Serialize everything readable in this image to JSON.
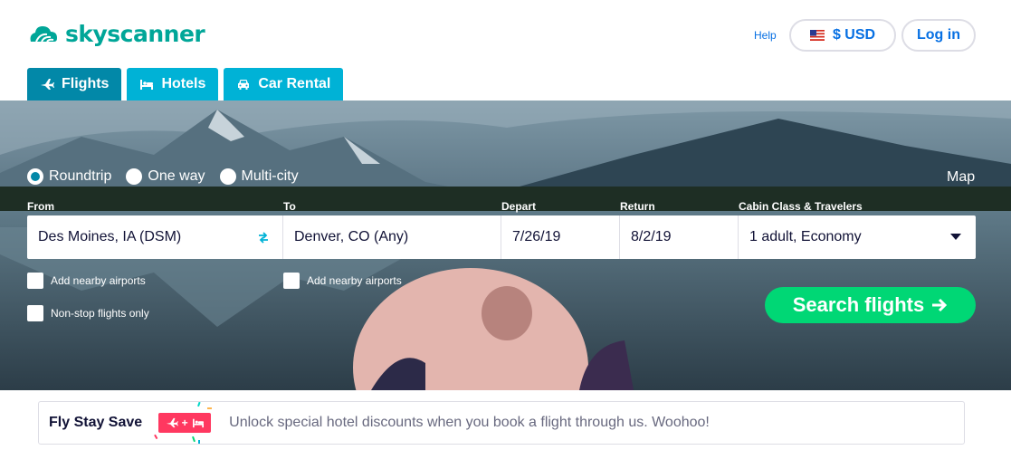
{
  "header": {
    "brand": "skyscanner",
    "help_label": "Help",
    "currency_label": "$ USD",
    "login_label": "Log in"
  },
  "tabs": [
    {
      "label": "Flights",
      "icon": "plane-icon",
      "active": true
    },
    {
      "label": "Hotels",
      "icon": "bed-icon",
      "active": false
    },
    {
      "label": "Car Rental",
      "icon": "car-icon",
      "active": false
    }
  ],
  "search": {
    "trip_types": [
      {
        "label": "Roundtrip",
        "checked": true
      },
      {
        "label": "One way",
        "checked": false
      },
      {
        "label": "Multi-city",
        "checked": false
      }
    ],
    "map_label": "Map",
    "labels": {
      "from": "From",
      "to": "To",
      "depart": "Depart",
      "return": "Return",
      "cabin": "Cabin Class & Travelers"
    },
    "values": {
      "from": "Des Moines, IA (DSM)",
      "to": "Denver, CO (Any)",
      "depart": "7/26/19",
      "return": "8/2/19",
      "cabin": "1 adult, Economy"
    },
    "options": {
      "nearby_from": "Add nearby airports",
      "nearby_to": "Add nearby airports",
      "nonstop": "Non-stop flights only"
    },
    "search_button": "Search flights"
  },
  "promo": {
    "title": "Fly Stay Save",
    "badge_plus": "+",
    "text": "Unlock special hotel discounts when you book a flight through us. Woohoo!"
  },
  "colors": {
    "brand": "#00a698",
    "link": "#0770e3",
    "tab": "#00b2d6",
    "tab_active": "#0288a8",
    "search_button": "#00d775",
    "promo_badge": "#ff3860"
  }
}
